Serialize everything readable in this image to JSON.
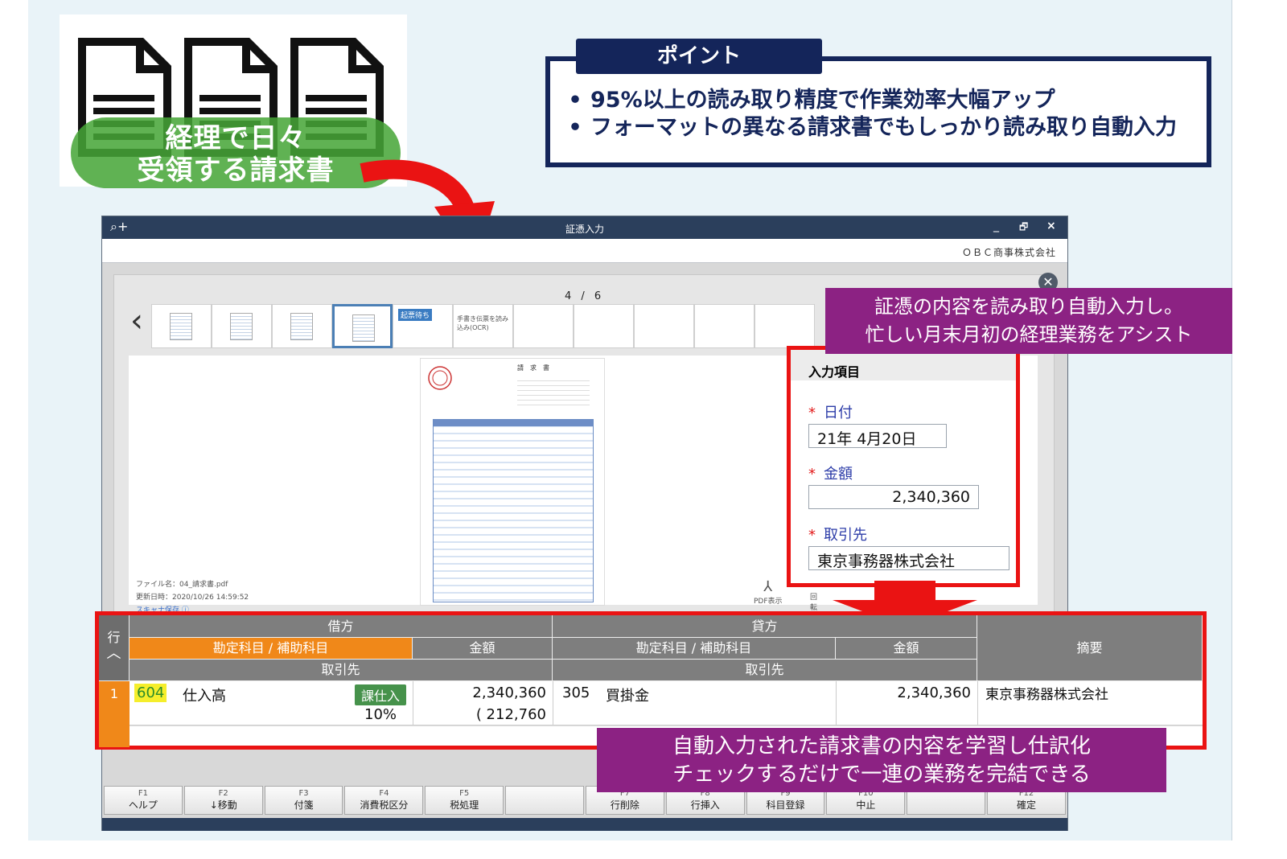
{
  "hero": {
    "label_line1": "経理で日々",
    "label_line2": "受領する請求書"
  },
  "point": {
    "title": "ポイント",
    "items": [
      "95%以上の読み取り精度で作業効率大幅アップ",
      "フォーマットの異なる請求書でもしっかり読み取り自動入力"
    ]
  },
  "window": {
    "title": "証憑入力",
    "zoom_icon": "zoom-plus-icon",
    "minimize": "_",
    "restore": "🗗",
    "close": "×",
    "company": "ＯＢＣ商事株式会社",
    "page_indicator": "4 / 6",
    "thumb_tag": "起票待ち",
    "thumb_text": "手書き伝票を読み込み(OCR)",
    "file_name": "ファイル名：04_請求書.pdf",
    "updated": "更新日時：2020/10/26 14:59:52",
    "scan_save": "スキャナ保存",
    "pdf_view": "PDF表示",
    "rotate": "回転",
    "invoice_title": "請　求　書"
  },
  "callouts": {
    "top_line1": "証憑の内容を読み取り自動入力し。",
    "top_line2": "忙しい月末月初の経理業務をアシスト",
    "bottom_line1": "自動入力された請求書の内容を学習し仕訳化",
    "bottom_line2": "チェックするだけで一連の業務を完結できる"
  },
  "inputs": {
    "header": "入力項目",
    "required_mark": "*",
    "date_label": "日付",
    "date_value": "21年  4月20日",
    "amount_label": "金額",
    "amount_value": "2,340,360",
    "partner_label": "取引先",
    "partner_value": "東京事務器株式会社"
  },
  "journal": {
    "row_header": "行",
    "debit": "借方",
    "credit": "貸方",
    "account_sub": "勘定科目 / 補助科目",
    "amount": "金額",
    "partner": "取引先",
    "summary": "摘要",
    "rows": [
      {
        "no": "1",
        "debit_code": "604",
        "debit_account": "仕入高",
        "tax_badge": "課仕入",
        "debit_amount": "2,340,360",
        "tax_rate": "10%",
        "tax_amount": "( 212,760",
        "credit_code": "305",
        "credit_account": "買掛金",
        "credit_amount": "2,340,360",
        "summary": "東京事務器株式会社"
      }
    ]
  },
  "fkeys": [
    {
      "num": "F1",
      "label": "ヘルプ"
    },
    {
      "num": "F2",
      "label": "↓移動"
    },
    {
      "num": "F3",
      "label": "付箋"
    },
    {
      "num": "F4",
      "label": "消費税区分"
    },
    {
      "num": "F5",
      "label": "税処理"
    },
    {
      "num": "",
      "label": ""
    },
    {
      "num": "F7",
      "label": "行削除"
    },
    {
      "num": "F8",
      "label": "行挿入"
    },
    {
      "num": "F9",
      "label": "科目登録"
    },
    {
      "num": "F10",
      "label": "中止"
    },
    {
      "num": "",
      "label": ""
    },
    {
      "num": "F12",
      "label": "確定"
    }
  ],
  "colors": {
    "navy": "#14255a",
    "magenta": "#8c2283",
    "red": "#ea1313",
    "orange": "#f08819",
    "green": "#46a537"
  }
}
